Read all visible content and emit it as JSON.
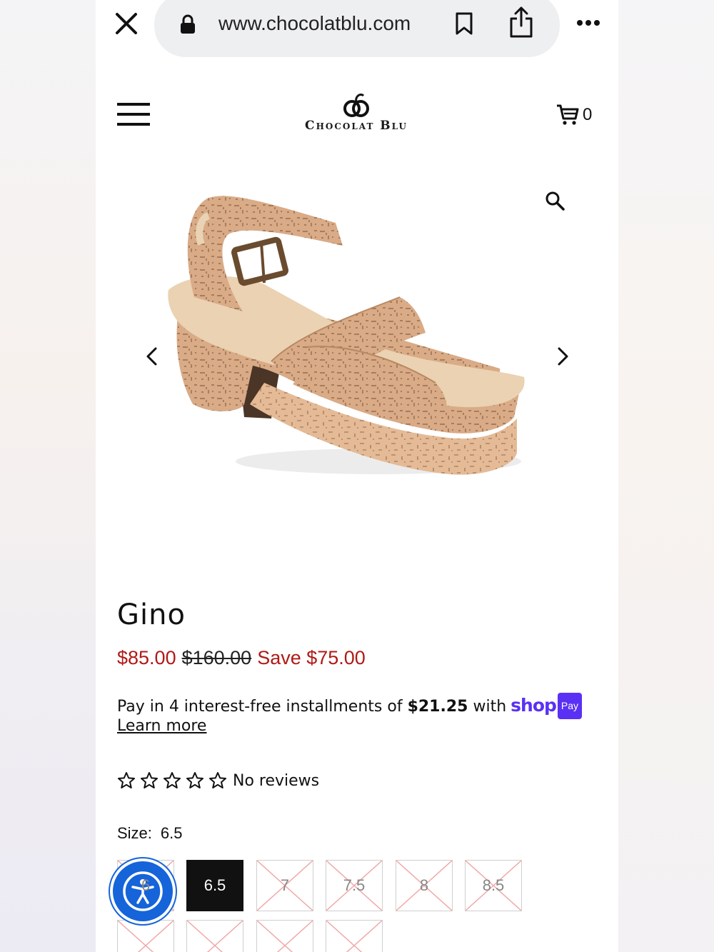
{
  "browser": {
    "url": "www.chocolatblu.com"
  },
  "header": {
    "logo_text": "Chocolat Blu",
    "cart_count": "0"
  },
  "product": {
    "title": "Gino",
    "price": "$85.00",
    "compare_price": "$160.00",
    "savings": "Save $75.00",
    "installments_prefix": "Pay in 4 interest-free installments of ",
    "installment_amount": "$21.25",
    "installments_suffix": " with",
    "shop_pay_word": "shop",
    "shop_pay_badge": "Pay",
    "learn_more": "Learn more",
    "rating_stars": 0,
    "reviews_text": "No reviews",
    "size_label": "Size:",
    "selected_size": "6.5",
    "sizes_row1": [
      {
        "label": "6",
        "available": false
      },
      {
        "label": "6.5",
        "available": true,
        "selected": true
      },
      {
        "label": "7",
        "available": false
      },
      {
        "label": "7.5",
        "available": false
      },
      {
        "label": "8",
        "available": false
      },
      {
        "label": "8.5",
        "available": false
      }
    ]
  },
  "colors": {
    "sale_red": "#b01a17",
    "shop_pay_purple": "#5a31f4",
    "accessibility_blue": "#1564d9"
  }
}
